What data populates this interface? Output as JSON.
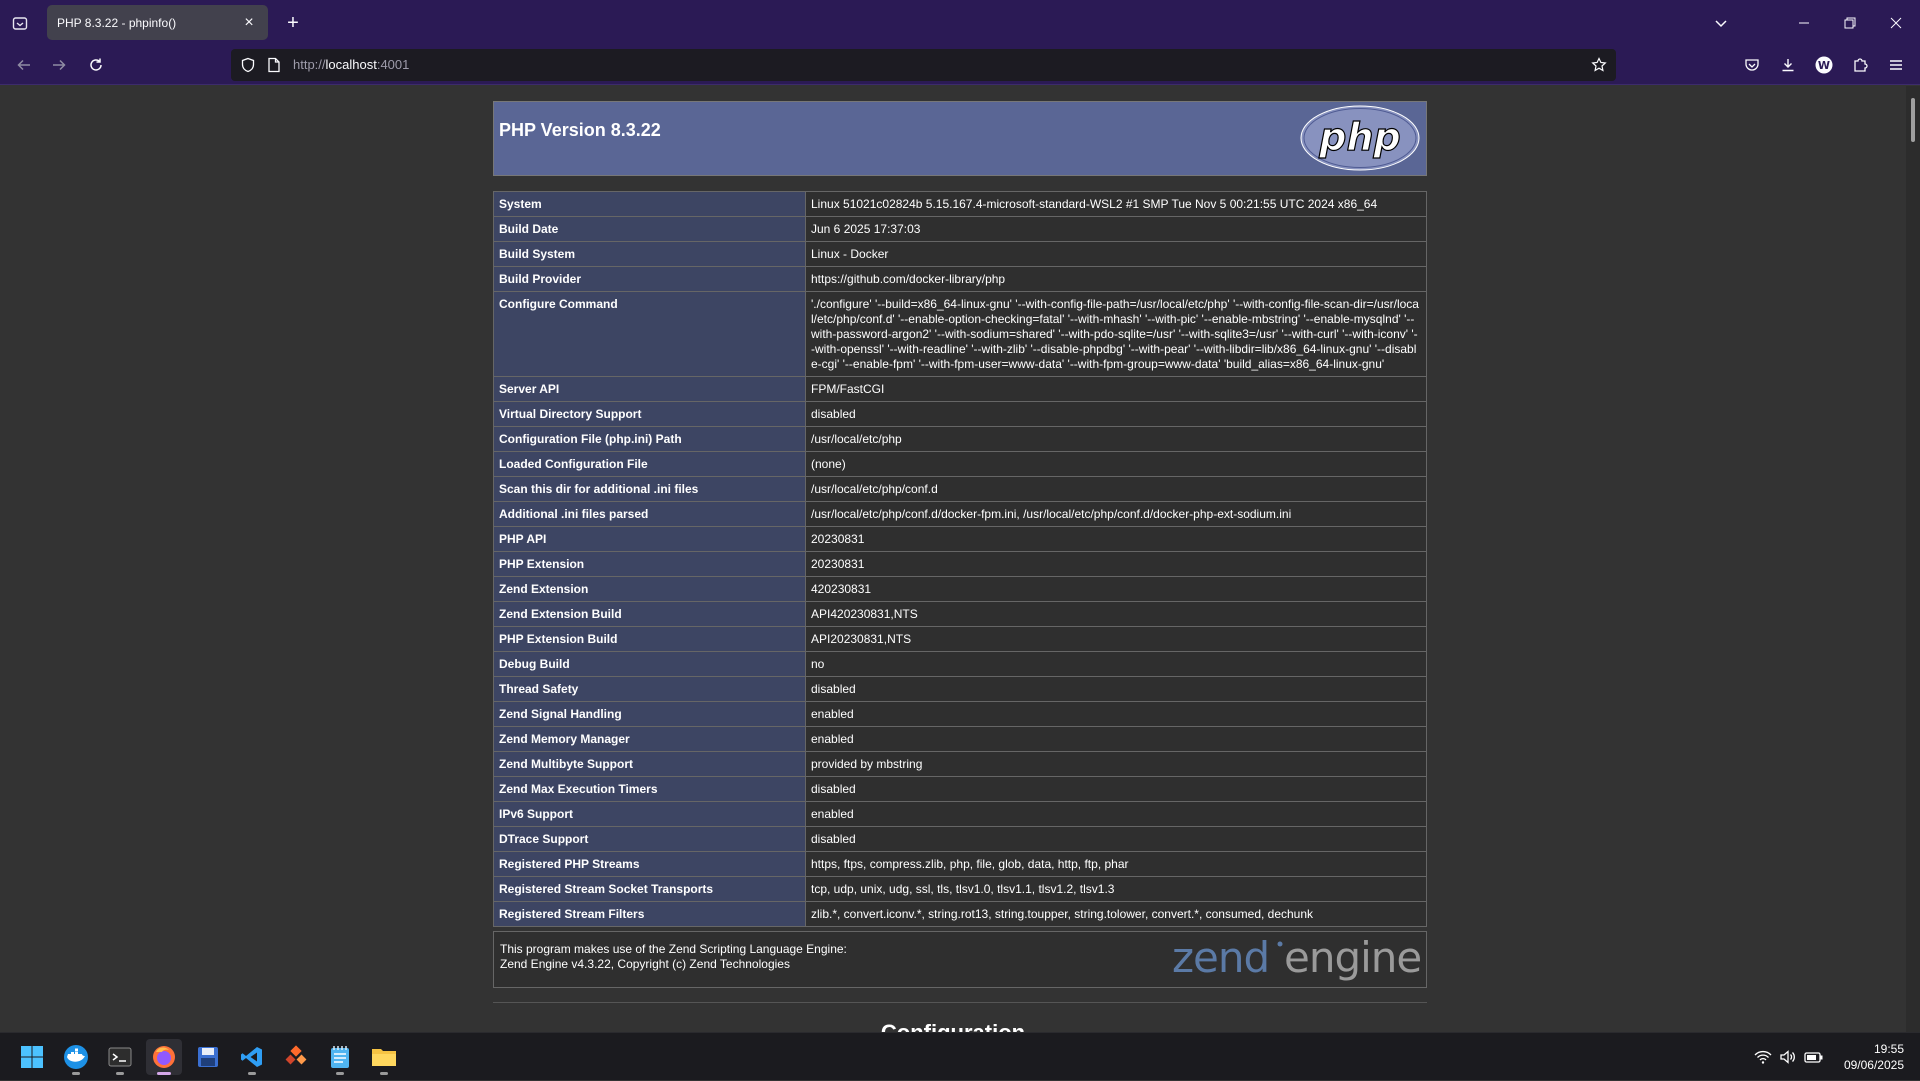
{
  "browser": {
    "tab_title": "PHP 8.3.22 - phpinfo()",
    "url_scheme": "http://",
    "url_host": "localhost",
    "url_port": ":4001"
  },
  "page": {
    "header_title": "PHP Version 8.3.22",
    "logo_text": "php",
    "rows": [
      {
        "key": "System",
        "value": "Linux 51021c02824b 5.15.167.4-microsoft-standard-WSL2 #1 SMP Tue Nov 5 00:21:55 UTC 2024 x86_64"
      },
      {
        "key": "Build Date",
        "value": "Jun 6 2025 17:37:03"
      },
      {
        "key": "Build System",
        "value": "Linux - Docker"
      },
      {
        "key": "Build Provider",
        "value": "https://github.com/docker-library/php"
      },
      {
        "key": "Configure Command",
        "value": "'./configure' '--build=x86_64-linux-gnu' '--with-config-file-path=/usr/local/etc/php' '--with-config-file-scan-dir=/usr/local/etc/php/conf.d' '--enable-option-checking=fatal' '--with-mhash' '--with-pic' '--enable-mbstring' '--enable-mysqlnd' '--with-password-argon2' '--with-sodium=shared' '--with-pdo-sqlite=/usr' '--with-sqlite3=/usr' '--with-curl' '--with-iconv' '--with-openssl' '--with-readline' '--with-zlib' '--disable-phpdbg' '--with-pear' '--with-libdir=lib/x86_64-linux-gnu' '--disable-cgi' '--enable-fpm' '--with-fpm-user=www-data' '--with-fpm-group=www-data' 'build_alias=x86_64-linux-gnu'"
      },
      {
        "key": "Server API",
        "value": "FPM/FastCGI"
      },
      {
        "key": "Virtual Directory Support",
        "value": "disabled"
      },
      {
        "key": "Configuration File (php.ini) Path",
        "value": "/usr/local/etc/php"
      },
      {
        "key": "Loaded Configuration File",
        "value": "(none)"
      },
      {
        "key": "Scan this dir for additional .ini files",
        "value": "/usr/local/etc/php/conf.d"
      },
      {
        "key": "Additional .ini files parsed",
        "value": "/usr/local/etc/php/conf.d/docker-fpm.ini, /usr/local/etc/php/conf.d/docker-php-ext-sodium.ini"
      },
      {
        "key": "PHP API",
        "value": "20230831"
      },
      {
        "key": "PHP Extension",
        "value": "20230831"
      },
      {
        "key": "Zend Extension",
        "value": "420230831"
      },
      {
        "key": "Zend Extension Build",
        "value": "API420230831,NTS"
      },
      {
        "key": "PHP Extension Build",
        "value": "API20230831,NTS"
      },
      {
        "key": "Debug Build",
        "value": "no"
      },
      {
        "key": "Thread Safety",
        "value": "disabled"
      },
      {
        "key": "Zend Signal Handling",
        "value": "enabled"
      },
      {
        "key": "Zend Memory Manager",
        "value": "enabled"
      },
      {
        "key": "Zend Multibyte Support",
        "value": "provided by mbstring"
      },
      {
        "key": "Zend Max Execution Timers",
        "value": "disabled"
      },
      {
        "key": "IPv6 Support",
        "value": "enabled"
      },
      {
        "key": "DTrace Support",
        "value": "disabled"
      },
      {
        "key": "Registered PHP Streams",
        "value": "https, ftps, compress.zlib, php, file, glob, data, http, ftp, phar"
      },
      {
        "key": "Registered Stream Socket Transports",
        "value": "tcp, udp, unix, udg, ssl, tls, tlsv1.0, tlsv1.1, tlsv1.2, tlsv1.3"
      },
      {
        "key": "Registered Stream Filters",
        "value": "zlib.*, convert.iconv.*, string.rot13, string.toupper, string.tolower, convert.*, consumed, dechunk"
      }
    ],
    "zend_line1": "This program makes use of the Zend Scripting Language Engine:",
    "zend_line2": "Zend Engine v4.3.22, Copyright (c) Zend Technologies",
    "zend_logo_word1": "zend",
    "zend_logo_word2": "engine",
    "config_heading": "Configuration"
  },
  "taskbar": {
    "apps": [
      "start-icon",
      "docker-icon",
      "terminal-icon",
      "firefox-icon",
      "save-disk-icon",
      "vscode-icon",
      "app-icon",
      "notepad-icon",
      "file-explorer-icon"
    ],
    "time": "19:55",
    "date": "09/06/2025"
  }
}
